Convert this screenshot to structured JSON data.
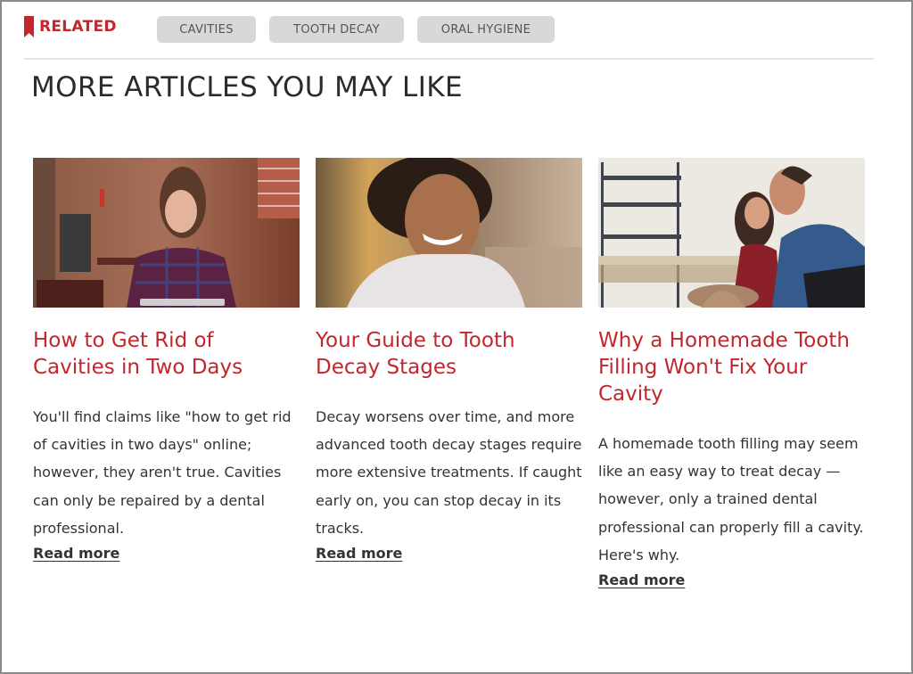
{
  "related": {
    "label": "RELATED",
    "icon": "bookmark-icon",
    "tags": [
      "CAVITIES",
      "TOOTH DECAY",
      "ORAL HYGIENE"
    ]
  },
  "section": {
    "heading": "MORE ARTICLES YOU MAY LIKE"
  },
  "colors": {
    "accent": "#c1272d",
    "tag_bg": "#d8d8d8",
    "text": "#333333"
  },
  "articles": [
    {
      "image_alt": "Woman in plaid shirt reading a tablet in a brick-walled cafe",
      "title": "How to Get Rid of Cavities in Two Days",
      "description": "You'll find claims like \"how to get rid of cavities in two days\" online; however, they aren't true. Cavities can only be repaired by a dental professional.",
      "link_label": "Read more"
    },
    {
      "image_alt": "Smiling man with curly hair in a white t-shirt",
      "title": "Your Guide to Tooth Decay Stages",
      "description": "Decay worsens over time, and more advanced tooth decay stages require more extensive treatments. If caught early on, you can stop decay in its tracks.",
      "link_label": "Read more"
    },
    {
      "image_alt": "Couple laughing while making pottery on a wheel",
      "title": "Why a Homemade Tooth Filling Won't Fix Your Cavity",
      "description": "A homemade tooth filling may seem like an easy way to treat decay — however, only a trained dental professional can properly fill a cavity. Here's why.",
      "link_label": "Read more"
    }
  ]
}
